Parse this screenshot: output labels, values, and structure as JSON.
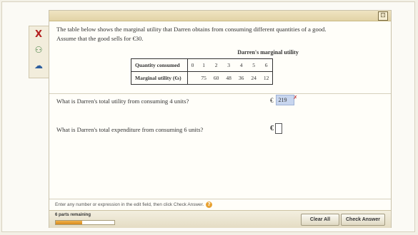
{
  "question": {
    "intro_line1": "The table below shows the marginal utility that Darren obtains from consuming different quantities of a good.",
    "intro_line2": "Assume that the good sells for €30."
  },
  "table": {
    "caption": "Darren's marginal utility",
    "row1_label": "Quantity consumed",
    "row1_values": [
      "0",
      "1",
      "2",
      "3",
      "4",
      "5",
      "6"
    ],
    "row2_label": "Marginal utility (€s)",
    "row2_values": [
      "",
      "75",
      "60",
      "48",
      "36",
      "24",
      "12"
    ]
  },
  "part1": {
    "prompt": "What is Darren's total utility from consuming 4 units?",
    "currency": "€",
    "answer": "219",
    "status_mark": "✗"
  },
  "part2": {
    "prompt": "What is Darren's total expenditure from consuming 6 units?",
    "currency": "€",
    "answer": ""
  },
  "footer": {
    "hint": "Enter any number or expression in the edit field, then click Check Answer.",
    "help_icon": "?",
    "parts_remaining": "6 parts remaining",
    "progress_fraction": 0.45
  },
  "buttons": {
    "clear_all": "Clear All",
    "check_answer": "Check Answer"
  },
  "tools": {
    "corner": "⊡",
    "x": "Ⅹ",
    "person": "⚇",
    "cloud": "☁"
  },
  "colors": {
    "answer_highlight": "#c8d6ef",
    "progress": "#e89a2a",
    "help": "#e8a232"
  }
}
